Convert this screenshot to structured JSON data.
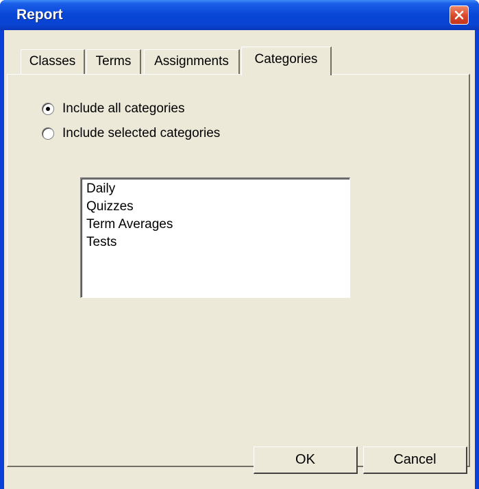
{
  "window": {
    "title": "Report"
  },
  "tabs": [
    {
      "label": "Classes",
      "active": false
    },
    {
      "label": "Terms",
      "active": false
    },
    {
      "label": "Assignments",
      "active": false
    },
    {
      "label": "Categories",
      "active": true
    }
  ],
  "categories_tab": {
    "options": [
      {
        "label": "Include all categories",
        "selected": true
      },
      {
        "label": "Include selected categories",
        "selected": false
      }
    ],
    "list_items": [
      "Daily",
      "Quizzes",
      "Term Averages",
      "Tests"
    ]
  },
  "buttons": {
    "ok_label": "OK",
    "cancel_label": "Cancel"
  },
  "colors": {
    "titlebar": "#0846d6",
    "dialog_face": "#ece9d8",
    "close_button": "#d9472b"
  },
  "icons": {
    "close": "close-icon",
    "radio": "radio-icon"
  }
}
